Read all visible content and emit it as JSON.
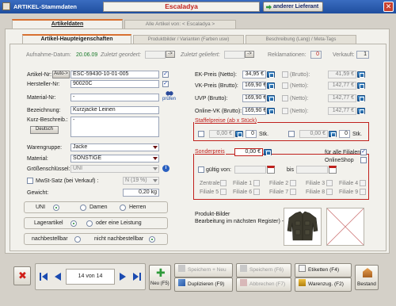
{
  "window": {
    "title": "ARTIKEL-Stammdaten",
    "article_name": "Escaladya",
    "other_supplier": "anderer Lieferant"
  },
  "tabs": {
    "main_active": "Artikeldaten",
    "main_other": "Alle Artikel von: < Escaladya >"
  },
  "subtabs": {
    "active": "Artikel-Haupteigenschaften",
    "images": "Produktbilder / Varianten (Farben usw)",
    "description": "Beschreibung (Lang) / Meta-Tags"
  },
  "info_bar": {
    "aufnahme_label": "Aufnahme-Datum:",
    "aufnahme_value": "20.06.09",
    "zuletzt_geordert": "Zuletzt geordert:",
    "zuletzt_geliefert": "Zuletzt geliefert:",
    "reklamationen_label": "Reklamationen:",
    "reklamationen_value": "0",
    "verkauft_label": "Verkauft:",
    "verkauft_value": "1"
  },
  "left": {
    "artikel_nr_label": "Artikel-Nr:",
    "auto_button": "Auto->",
    "artikel_nr_value": "ESC-59430-10-01-005",
    "hersteller_nr_label": "Hersteller-Nr:",
    "hersteller_nr_value": "90020C",
    "material_nr_label": "Material-Nr:",
    "material_nr_value": "-",
    "pruefen_label": "prüfen",
    "bezeichnung_label": "Bezeichnung:",
    "bezeichnung_value": "Kurzjacke Leinen",
    "kurz_beschreib_label": "Kurz-Beschreib.:",
    "kurz_beschreib_value": "-",
    "deutsch_button": "Deutsch",
    "warengruppe_label": "Warengruppe:",
    "warengruppe_value": "Jacke",
    "material_label": "Material:",
    "material_value": "SONSTIGE",
    "groessen_label": "Größenschlüssel:",
    "groessen_value": "UNI",
    "mwst_label": "MwSt-Satz (bei Verkauf) :",
    "mwst_value": "N (19 %)",
    "gewicht_label": "Gewicht:",
    "gewicht_value": "0,20 kg"
  },
  "gender": {
    "uni": "UNI",
    "damen": "Damen",
    "herren": "Herren"
  },
  "stock": {
    "lagerartikel": "Lagerartikel",
    "oder_leistung": "oder eine Leistung"
  },
  "reorder": {
    "nachbestellbar": "nachbestellbar",
    "nicht": "nicht nachbestellbar"
  },
  "prices": {
    "ek_netto_label": "EK-Preis (Netto):",
    "ek_netto_value": "34,95 €",
    "vk_brutto_label": "VK-Preis (Brutto):",
    "vk_brutto_value": "169,90 €",
    "uvp_label": "UVP (Brutto):",
    "uvp_value": "169,90 €",
    "online_vk_label": "Online-VK (Brutto):",
    "online_vk_value": "169,90 €",
    "brutto_label": "(Brutto):",
    "brutto_value": "41,59 €",
    "netto_label": "(Netto):",
    "netto_value_1": "142,77 €",
    "netto_value_2": "142,77 €",
    "netto_value_3": "142,77 €"
  },
  "staffel": {
    "title": "Staffelpreise (ab x Stück)",
    "price1": "0,00 €",
    "price2": "0,00 €",
    "qty1": "0",
    "qty2": "0",
    "stk": "Stk."
  },
  "sonderpreis": {
    "label": "Sonderpreis",
    "value": "0,00 €",
    "fuer_alle": "für alle Filialen",
    "onlineshop": "OnlineShop",
    "gueltig_von": "gültig von:",
    "bis": "bis",
    "filialen": [
      "Zentrale",
      "Filiale 1",
      "Filiale 2",
      "Filiale 3",
      "Filiale 4",
      "Filiale 5",
      "Filiale 6",
      "Filiale 7",
      "Filiale 8",
      "Filiale 9"
    ]
  },
  "produkt_bilder": {
    "line1": "Produkt-Bilder",
    "line2": "Bearbeitung im nächsten Register) ->"
  },
  "nav": {
    "record": "14 von 14"
  },
  "toolbar": {
    "neu": "Neu (F5)",
    "speichern_neu": "Speichern + Neu",
    "duplizieren": "Duplizieren (F9)",
    "speichern": "Speichern (F6)",
    "abbrechen": "Abbrechen (F7)",
    "etiketten": "Etiketten (F4)",
    "warenzug": "Warenzug. (F2)",
    "bestand": "Bestand"
  },
  "colors": {
    "title_bar": "#1f4e9e",
    "accent_red": "#c0201c",
    "tab_orange": "#d87030"
  }
}
